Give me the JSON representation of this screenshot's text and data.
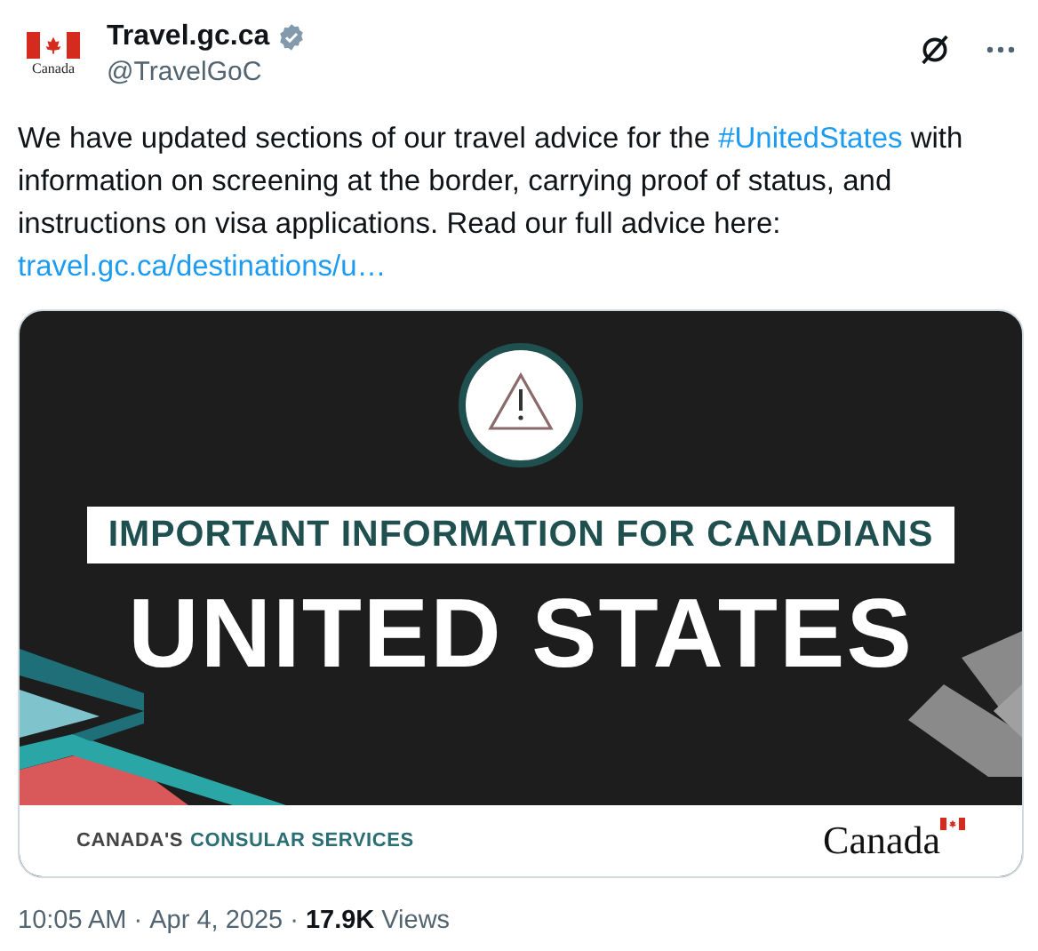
{
  "author": {
    "name": "Travel.gc.ca",
    "handle": "@TravelGoC",
    "verified": true,
    "avatar_caption": "Canada"
  },
  "body": [
    {
      "kind": "text",
      "text": "We have updated sections of our travel advice for the "
    },
    {
      "kind": "hashtag",
      "text": "#UnitedStates"
    },
    {
      "kind": "text",
      "text": " with information on screening at the border, carrying proof of status, and instructions on visa applications. Read our full advice here: "
    },
    {
      "kind": "link",
      "text": "travel.gc.ca/destinations/u…"
    }
  ],
  "media": {
    "banner": "IMPORTANT INFORMATION FOR CANADIANS",
    "title": "UNITED STATES",
    "footer_prefix": "CANADA'S",
    "footer_suffix": "CONSULAR SERVICES",
    "wordmark": "Canada"
  },
  "meta": {
    "time": "10:05 AM",
    "separator": "·",
    "date": "Apr 4, 2025",
    "views_count": "17.9K",
    "views_label": "Views"
  }
}
